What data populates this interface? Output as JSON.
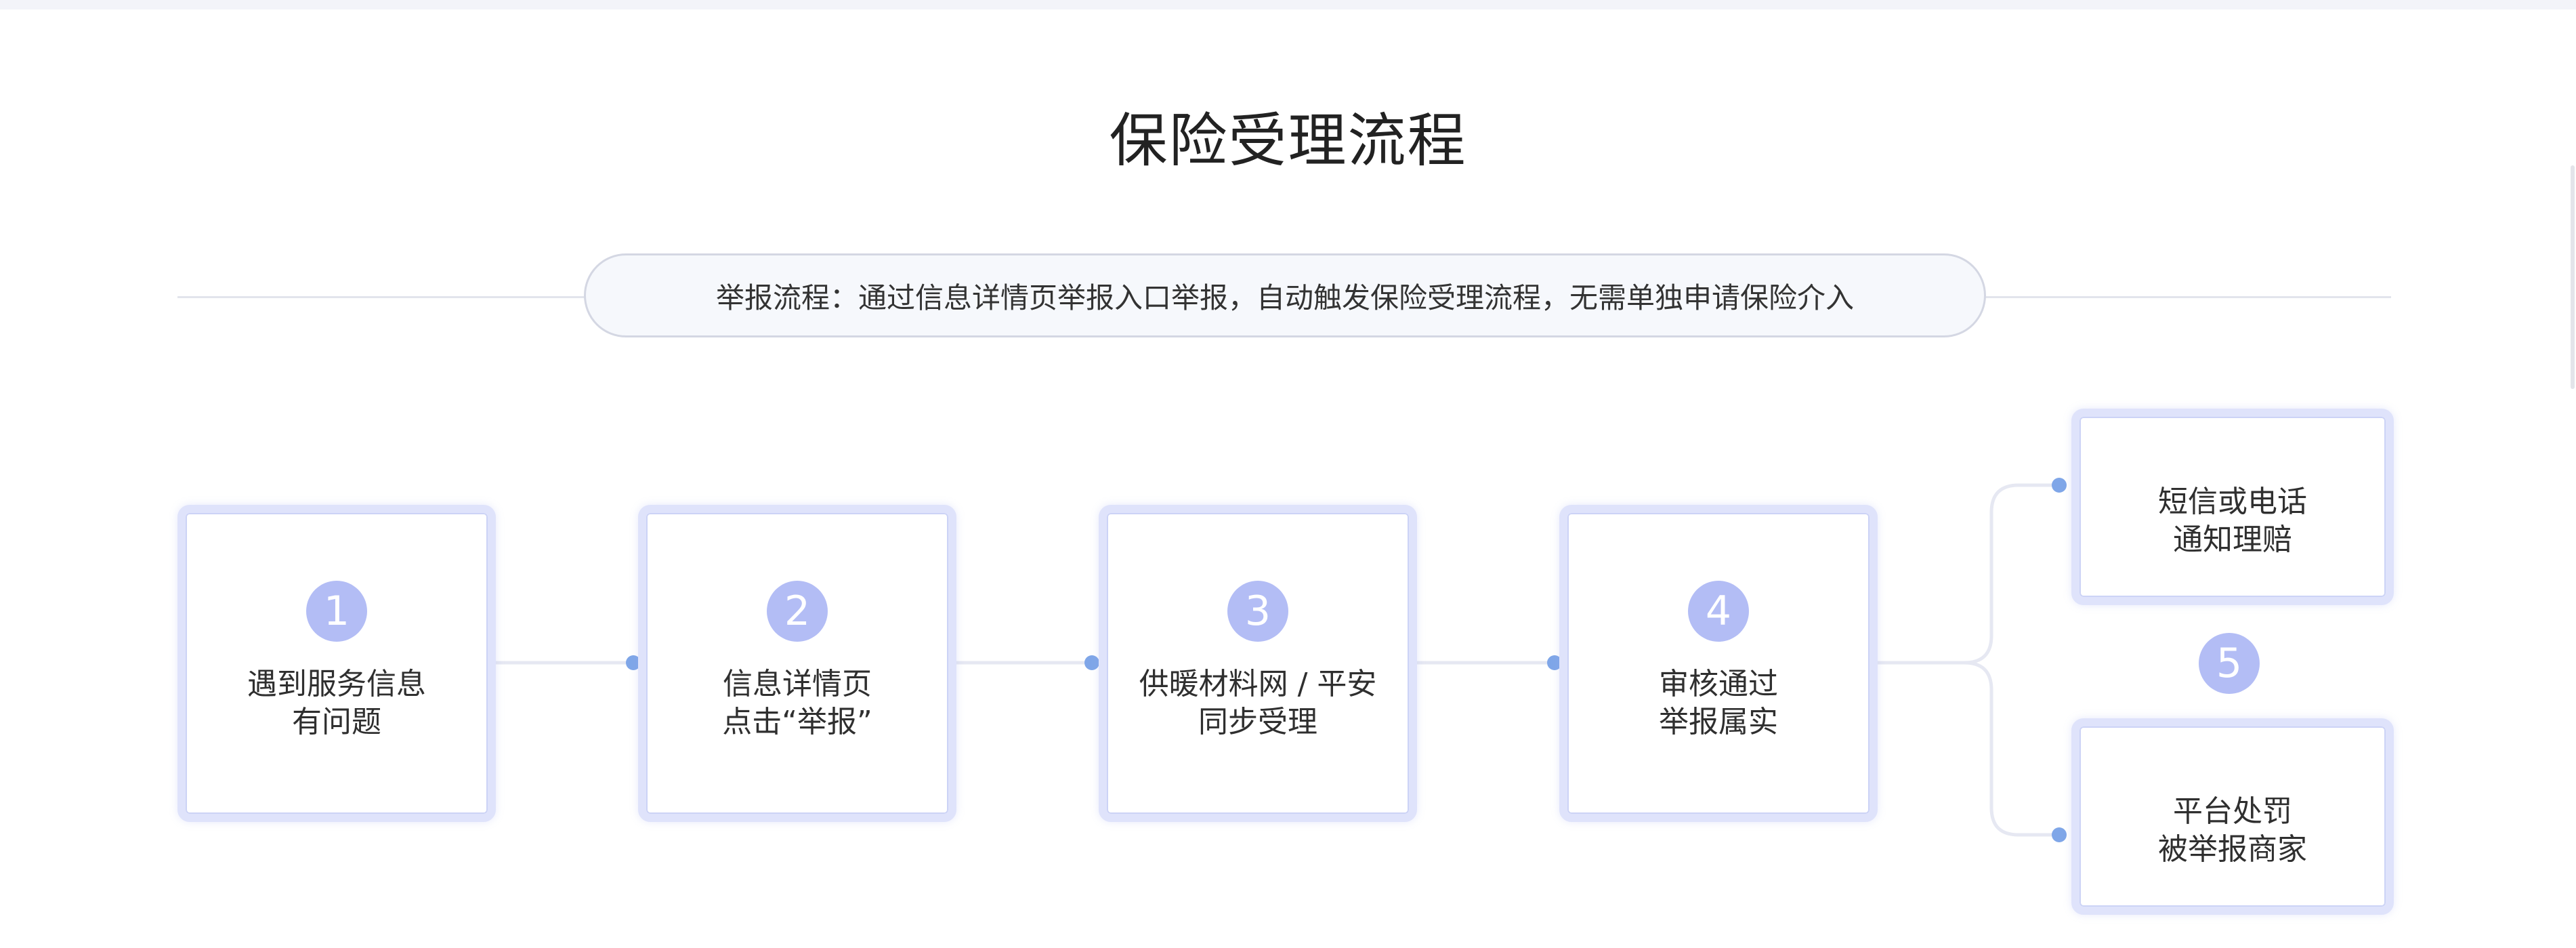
{
  "title": "保险受理流程",
  "banner": "举报流程：通过信息详情页举报入口举报，自动触发保险受理流程，无需单独申请保险介入",
  "steps": [
    {
      "number": "1",
      "line1": "遇到服务信息",
      "line2": "有问题"
    },
    {
      "number": "2",
      "line1": "信息详情页",
      "line2": "点击“举报”"
    },
    {
      "number": "3",
      "line1": "供暖材料网 / 平安",
      "line2": "同步受理"
    },
    {
      "number": "4",
      "line1": "审核通过",
      "line2": "举报属实"
    }
  ],
  "final_step": {
    "number": "5",
    "outcomes": [
      {
        "line1": "短信或电话",
        "line2": "通知理赔"
      },
      {
        "line1": "平台处罚",
        "line2": "被举报商家"
      }
    ]
  },
  "colors": {
    "card_border": "#dfe3fb",
    "badge": "#b3bdf5",
    "connector_dot": "#7fa6e8",
    "connector_line": "#e6e8f2"
  }
}
